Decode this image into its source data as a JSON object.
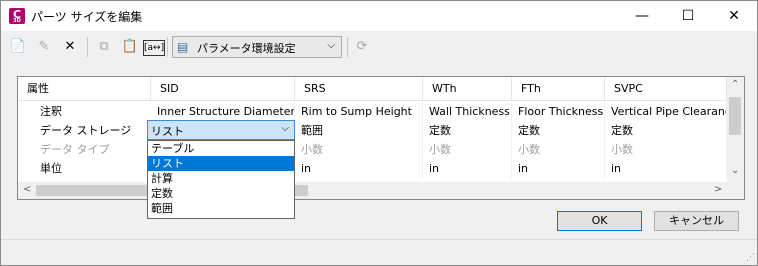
{
  "window": {
    "title": "パーツ サイズを編集",
    "app_icon_letter": "C",
    "app_icon_sub": "3D",
    "minimize": "—",
    "maximize": "☐",
    "close": "✕"
  },
  "toolbar": {
    "new": "📄",
    "edit": "✎",
    "delete": "✕",
    "copy": "⧉",
    "paste": "📋",
    "rename": "[a↔]",
    "param_combo": "パラメータ環境設定",
    "refresh": "⟳"
  },
  "grid": {
    "headers": [
      "属性",
      "SID",
      "SRS",
      "WTh",
      "FTh",
      "SVPC"
    ],
    "rows": [
      {
        "label": "注釈",
        "cells": [
          "Inner Structure Diameter",
          "Rim to Sump Height",
          "Wall Thickness",
          "Floor Thickness",
          "Vertical Pipe Clearance"
        ]
      },
      {
        "label": "データ ストレージ",
        "cells": [
          "リスト",
          "範囲",
          "定数",
          "定数",
          "定数"
        ]
      },
      {
        "label": "データ タイプ",
        "cells": [
          "",
          "小数",
          "小数",
          "小数",
          "小数"
        ]
      },
      {
        "label": "単位",
        "cells": [
          "",
          "in",
          "in",
          "in",
          "in"
        ]
      }
    ]
  },
  "dropdown": {
    "value": "リスト",
    "options": [
      "テーブル",
      "リスト",
      "計算",
      "定数",
      "範囲"
    ],
    "selected_index": 1
  },
  "buttons": {
    "ok": "OK",
    "cancel": "キャンセル"
  },
  "colors": {
    "accent": "#0078d7",
    "app_icon": "#b4006e"
  }
}
